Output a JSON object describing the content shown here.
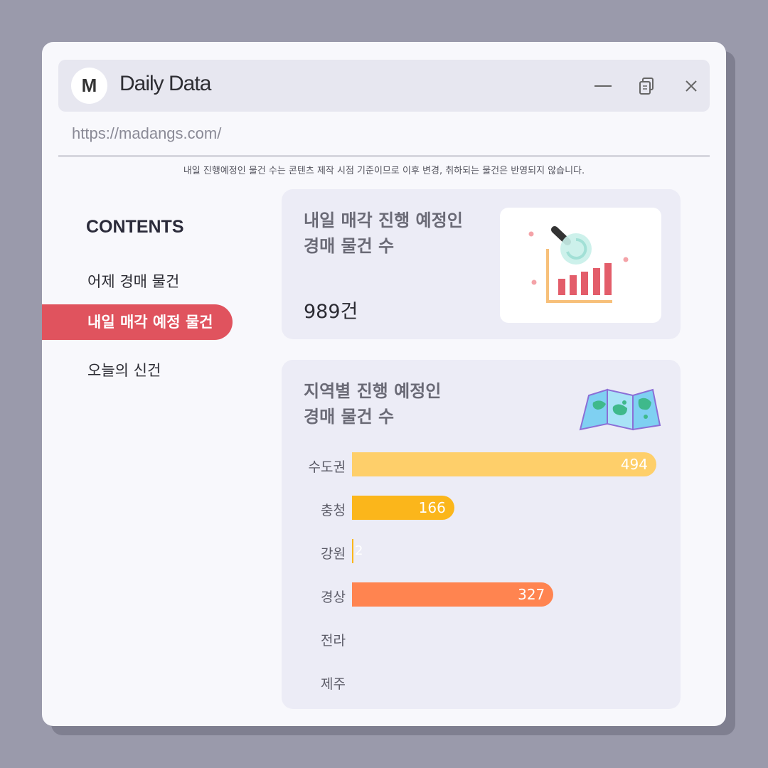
{
  "window": {
    "logo_letter": "M",
    "title": "Daily Data",
    "url": "https://madangs.com/"
  },
  "notice": "내일 진행예정인 물건 수는 콘텐츠 제작 시점 기준이므로 이후 변경, 취하되는 물건은 반영되지 않습니다.",
  "sidebar": {
    "heading": "CONTENTS",
    "items": [
      {
        "label": "어제 경매 물건"
      },
      {
        "label": "내일 매각 예정 물건"
      },
      {
        "label": "오늘의 신건"
      }
    ]
  },
  "summary_card": {
    "title": "내일 매각 진행 예정인\n경매 물건 수",
    "count": "989건"
  },
  "region_card": {
    "title": "지역별 진행 예정인\n경매 물건 수"
  },
  "chart_data": {
    "type": "bar",
    "orientation": "horizontal",
    "categories": [
      "수도권",
      "충청",
      "강원",
      "경상",
      "전라",
      "제주"
    ],
    "values": [
      494,
      166,
      2,
      327,
      0,
      0
    ],
    "value_labels": [
      "494",
      "166",
      "2",
      "327",
      "",
      ""
    ],
    "colors": [
      "#fecf6a",
      "#fbb61b",
      "#fbb61b",
      "#ff8450",
      "#ff8450",
      "#ff8450"
    ],
    "xlim": [
      0,
      494
    ]
  }
}
